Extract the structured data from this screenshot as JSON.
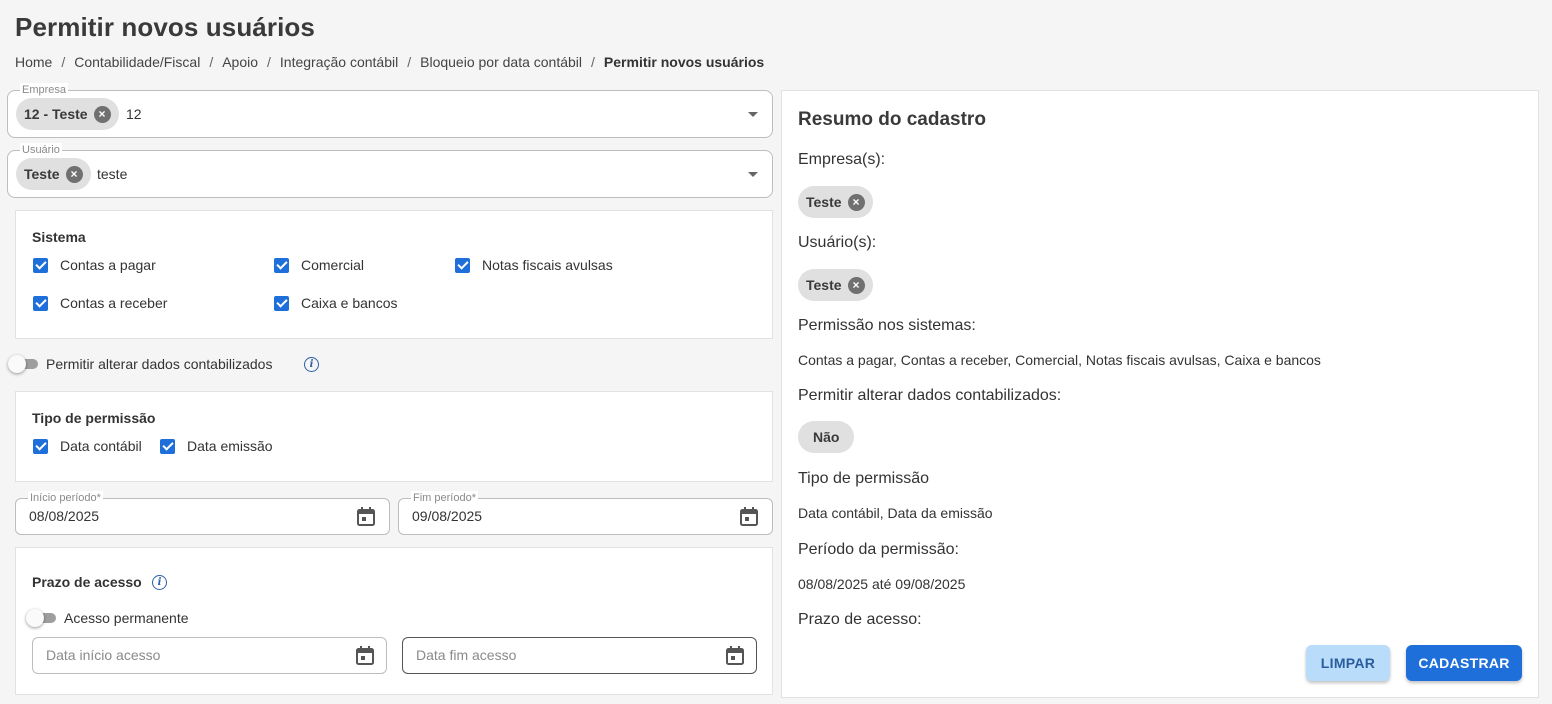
{
  "page": {
    "title": "Permitir novos usuários",
    "breadcrumb": [
      "Home",
      "Contabilidade/Fiscal",
      "Apoio",
      "Integração contábil",
      "Bloqueio por data contábil",
      "Permitir novos usuários"
    ]
  },
  "empresa": {
    "label": "Empresa",
    "chip": "12 - Teste",
    "input": "12"
  },
  "usuario": {
    "label": "Usuário",
    "chip": "Teste",
    "input": "teste"
  },
  "sistema": {
    "title": "Sistema",
    "options": [
      {
        "label": "Contas a pagar",
        "checked": true
      },
      {
        "label": "Comercial",
        "checked": true
      },
      {
        "label": "Notas fiscais avulsas",
        "checked": true
      },
      {
        "label": "Contas a receber",
        "checked": true
      },
      {
        "label": "Caixa e bancos",
        "checked": true
      }
    ]
  },
  "alterar_toggle": {
    "label": "Permitir alterar dados contabilizados",
    "on": false
  },
  "tipo_permissao": {
    "title": "Tipo de permissão",
    "options": [
      {
        "label": "Data contábil",
        "checked": true
      },
      {
        "label": "Data emissão",
        "checked": true
      }
    ]
  },
  "periodo": {
    "inicio_label": "Início período*",
    "inicio_value": "08/08/2025",
    "fim_label": "Fim período*",
    "fim_value": "09/08/2025"
  },
  "prazo": {
    "title": "Prazo de acesso",
    "toggle_label": "Acesso permanente",
    "toggle_on": false,
    "inicio_placeholder": "Data início acesso",
    "fim_placeholder": "Data fim acesso"
  },
  "resumo": {
    "title": "Resumo do cadastro",
    "empresas_label": "Empresa(s):",
    "empresas_chip": "Teste",
    "usuarios_label": "Usuário(s):",
    "usuarios_chip": "Teste",
    "sistemas_label": "Permissão nos sistemas:",
    "sistemas_value": "Contas a pagar, Contas a receber, Comercial, Notas fiscais avulsas, Caixa e bancos",
    "alterar_label": "Permitir alterar dados contabilizados:",
    "alterar_value": "Não",
    "tipo_label": "Tipo de permissão",
    "tipo_value": "Data contábil, Data da emissão",
    "periodo_label": "Período da permissão:",
    "periodo_value": "08/08/2025 até 09/08/2025",
    "prazo_label": "Prazo de acesso:"
  },
  "actions": {
    "clear": "LIMPAR",
    "save": "CADASTRAR"
  },
  "colors": {
    "primary": "#1e6fd9",
    "secondary": "#b9dcfb",
    "chip": "#e0e0e0"
  },
  "icons": {
    "info": "info-icon",
    "calendar": "calendar-icon",
    "chip_remove": "close-circle-icon",
    "dropdown": "caret-down-icon"
  }
}
